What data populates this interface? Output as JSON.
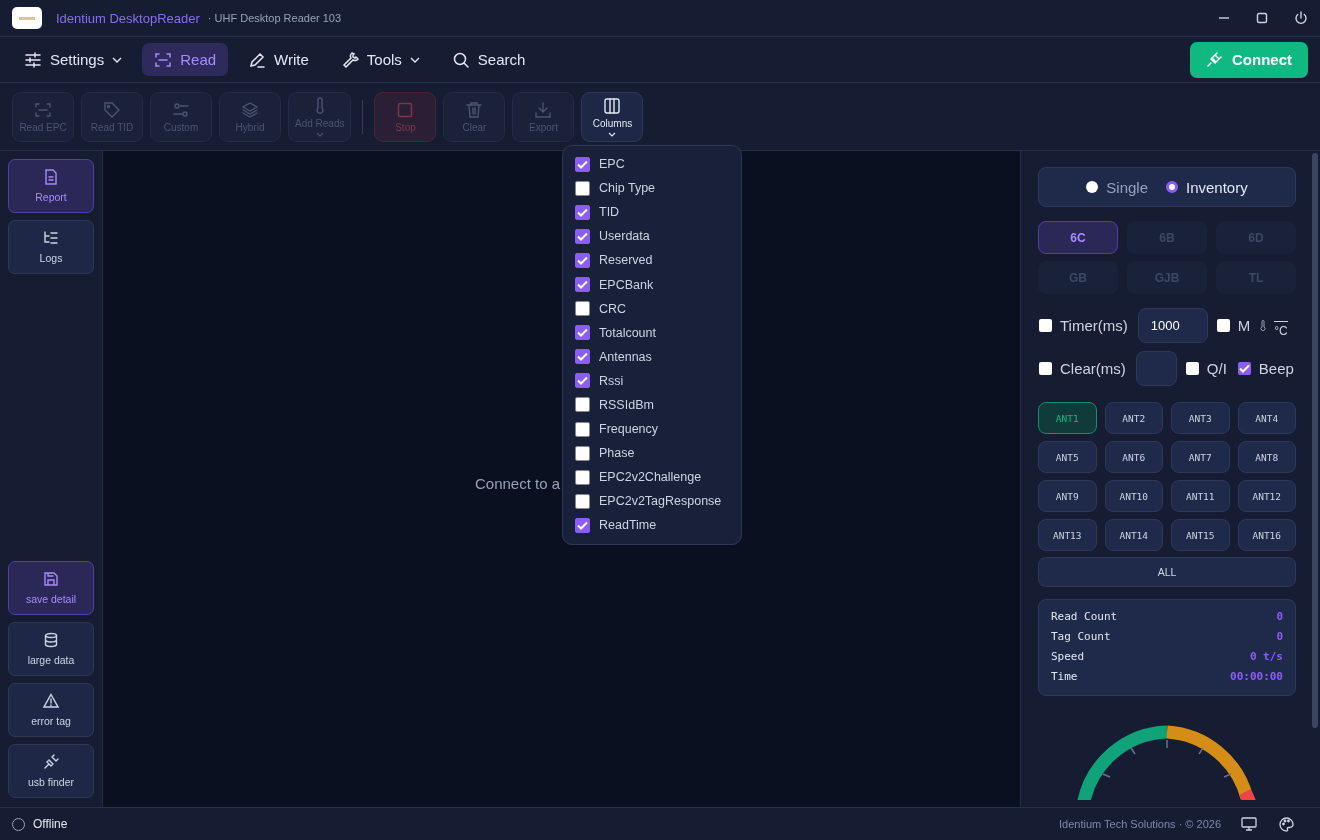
{
  "window": {
    "app_name": "Identium DesktopReader",
    "subtitle": "· UHF Desktop Reader 103"
  },
  "nav": [
    {
      "label": "Settings",
      "selected": false,
      "dropdown": true
    },
    {
      "label": "Read",
      "selected": true,
      "dropdown": false
    },
    {
      "label": "Write",
      "selected": false,
      "dropdown": false
    },
    {
      "label": "Tools",
      "selected": false,
      "dropdown": true
    },
    {
      "label": "Search",
      "selected": false,
      "dropdown": false
    }
  ],
  "connect_button": "Connect",
  "toolbar": [
    {
      "label": "Read EPC",
      "kind": "normal",
      "disabled": true,
      "dropdown": false
    },
    {
      "label": "Read TID",
      "kind": "normal",
      "disabled": true,
      "dropdown": false
    },
    {
      "label": "Custom",
      "kind": "normal",
      "disabled": true,
      "dropdown": false
    },
    {
      "label": "Hybrid",
      "kind": "normal",
      "disabled": true,
      "dropdown": false
    },
    {
      "label": "Add Reads",
      "kind": "normal",
      "disabled": true,
      "dropdown": true
    },
    {
      "label": "Stop",
      "kind": "danger",
      "disabled": true,
      "dropdown": false
    },
    {
      "label": "Clear",
      "kind": "normal",
      "disabled": true,
      "dropdown": false
    },
    {
      "label": "Export",
      "kind": "normal",
      "disabled": true,
      "dropdown": false
    },
    {
      "label": "Columns",
      "kind": "normal",
      "disabled": false,
      "dropdown": true
    }
  ],
  "columns_menu": [
    {
      "label": "EPC",
      "checked": true
    },
    {
      "label": "Chip Type",
      "checked": false
    },
    {
      "label": "TID",
      "checked": true
    },
    {
      "label": "Userdata",
      "checked": true
    },
    {
      "label": "Reserved",
      "checked": true
    },
    {
      "label": "EPCBank",
      "checked": true
    },
    {
      "label": "CRC",
      "checked": false
    },
    {
      "label": "Totalcount",
      "checked": true
    },
    {
      "label": "Antennas",
      "checked": true
    },
    {
      "label": "Rssi",
      "checked": true
    },
    {
      "label": "RSSIdBm",
      "checked": false
    },
    {
      "label": "Frequency",
      "checked": false
    },
    {
      "label": "Phase",
      "checked": false
    },
    {
      "label": "EPC2v2Challenge",
      "checked": false
    },
    {
      "label": "EPC2v2TagResponse",
      "checked": false
    },
    {
      "label": "ReadTime",
      "checked": true
    }
  ],
  "sidebar": {
    "top": [
      {
        "label": "Report",
        "selected": true
      },
      {
        "label": "Logs",
        "selected": false
      }
    ],
    "bottom": [
      {
        "label": "save detail",
        "selected": true
      },
      {
        "label": "large data",
        "selected": false
      },
      {
        "label": "error tag",
        "selected": false
      },
      {
        "label": "usb finder",
        "selected": false
      }
    ]
  },
  "center_message": "Connect to a",
  "mode": [
    {
      "label": "Single",
      "selected": false
    },
    {
      "label": "Inventory",
      "selected": true
    }
  ],
  "protocols": [
    {
      "label": "6C",
      "selected": true
    },
    {
      "label": "6B",
      "selected": false
    },
    {
      "label": "6D",
      "selected": false
    },
    {
      "label": "GB",
      "selected": false
    },
    {
      "label": "GJB",
      "selected": false
    },
    {
      "label": "TL",
      "selected": false
    }
  ],
  "timer": {
    "label": "Timer(ms)",
    "checked": false,
    "value": "1000"
  },
  "m_option": {
    "label": "M",
    "checked": false
  },
  "temperature_unit": "°C",
  "clear": {
    "label": "Clear(ms)",
    "checked": false
  },
  "qi_option": {
    "label": "Q/I",
    "checked": false
  },
  "beep_option": {
    "label": "Beep",
    "checked": true
  },
  "antennas": [
    {
      "label": "ANT1",
      "selected": true
    },
    {
      "label": "ANT2",
      "selected": false
    },
    {
      "label": "ANT3",
      "selected": false
    },
    {
      "label": "ANT4",
      "selected": false
    },
    {
      "label": "ANT5",
      "selected": false
    },
    {
      "label": "ANT6",
      "selected": false
    },
    {
      "label": "ANT7",
      "selected": false
    },
    {
      "label": "ANT8",
      "selected": false
    },
    {
      "label": "ANT9",
      "selected": false
    },
    {
      "label": "ANT10",
      "selected": false
    },
    {
      "label": "ANT11",
      "selected": false
    },
    {
      "label": "ANT12",
      "selected": false
    },
    {
      "label": "ANT13",
      "selected": false
    },
    {
      "label": "ANT14",
      "selected": false
    },
    {
      "label": "ANT15",
      "selected": false
    },
    {
      "label": "ANT16",
      "selected": false
    }
  ],
  "all_button": "ALL",
  "stats": [
    {
      "label": "Read Count",
      "value": "0"
    },
    {
      "label": "Tag Count",
      "value": "0"
    },
    {
      "label": "Speed",
      "value": "0 t/s"
    },
    {
      "label": "Time",
      "value": "00:00:00"
    }
  ],
  "status_bar": {
    "status": "Offline",
    "footer": "Identium Tech Solutions · © 2026"
  }
}
